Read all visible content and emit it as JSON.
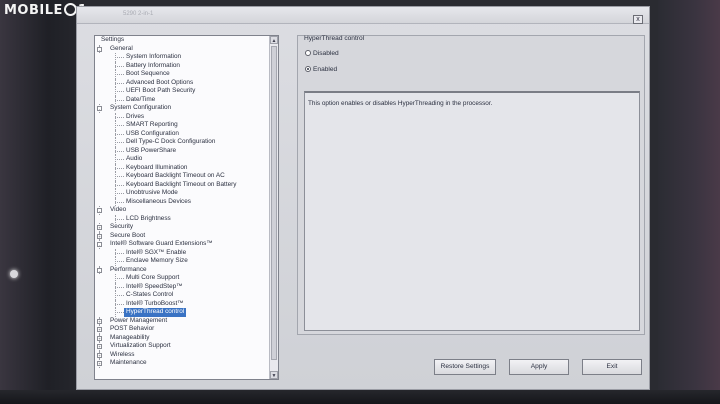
{
  "photo": {
    "watermark": "MOBILE",
    "watermark_tail": "1"
  },
  "window": {
    "title": "5290 2-in-1",
    "close_label": "x"
  },
  "tree": {
    "items": [
      {
        "label": "Settings",
        "level": 0,
        "expander": ""
      },
      {
        "label": "General",
        "level": 1,
        "expander": "-"
      },
      {
        "label": "System Information",
        "level": 2
      },
      {
        "label": "Battery Information",
        "level": 2
      },
      {
        "label": "Boot Sequence",
        "level": 2
      },
      {
        "label": "Advanced Boot Options",
        "level": 2
      },
      {
        "label": "UEFI Boot Path Security",
        "level": 2
      },
      {
        "label": "Date/Time",
        "level": 2
      },
      {
        "label": "System Configuration",
        "level": 1,
        "expander": "-"
      },
      {
        "label": "Drives",
        "level": 2
      },
      {
        "label": "SMART Reporting",
        "level": 2
      },
      {
        "label": "USB Configuration",
        "level": 2
      },
      {
        "label": "Dell Type-C Dock Configuration",
        "level": 2
      },
      {
        "label": "USB PowerShare",
        "level": 2
      },
      {
        "label": "Audio",
        "level": 2
      },
      {
        "label": "Keyboard Illumination",
        "level": 2
      },
      {
        "label": "Keyboard Backlight Timeout on AC",
        "level": 2
      },
      {
        "label": "Keyboard Backlight Timeout on Battery",
        "level": 2
      },
      {
        "label": "Unobtrusive Mode",
        "level": 2
      },
      {
        "label": "Miscellaneous Devices",
        "level": 2
      },
      {
        "label": "Video",
        "level": 1,
        "expander": "-"
      },
      {
        "label": "LCD Brightness",
        "level": 2
      },
      {
        "label": "Security",
        "level": 1,
        "expander": "+"
      },
      {
        "label": "Secure Boot",
        "level": 1,
        "expander": "+"
      },
      {
        "label": "Intel® Software Guard Extensions™",
        "level": 1,
        "expander": "-"
      },
      {
        "label": "Intel® SGX™ Enable",
        "level": 2
      },
      {
        "label": "Enclave Memory Size",
        "level": 2
      },
      {
        "label": "Performance",
        "level": 1,
        "expander": "-"
      },
      {
        "label": "Multi Core Support",
        "level": 2
      },
      {
        "label": "Intel® SpeedStep™",
        "level": 2
      },
      {
        "label": "C-States Control",
        "level": 2
      },
      {
        "label": "Intel® TurboBoost™",
        "level": 2
      },
      {
        "label": "HyperThread control",
        "level": 2,
        "selected": true
      },
      {
        "label": "Power Management",
        "level": 1,
        "expander": "+"
      },
      {
        "label": "POST Behavior",
        "level": 1,
        "expander": "+"
      },
      {
        "label": "Manageability",
        "level": 1,
        "expander": "+"
      },
      {
        "label": "Virtualization Support",
        "level": 1,
        "expander": "+"
      },
      {
        "label": "Wireless",
        "level": 1,
        "expander": "+"
      },
      {
        "label": "Maintenance",
        "level": 1,
        "expander": "+"
      }
    ],
    "scroll_up": "▲",
    "scroll_down": "▼"
  },
  "panel": {
    "group_title": "HyperThread control",
    "options": [
      {
        "label": "Disabled",
        "checked": false
      },
      {
        "label": "Enabled",
        "checked": true
      }
    ],
    "description": "This option enables or disables HyperThreading in the processor."
  },
  "buttons": {
    "restore": "Restore Settings",
    "apply": "Apply",
    "exit": "Exit"
  },
  "colors": {
    "selection": "#3a73c4",
    "window_bg": "#d6d7dc"
  }
}
